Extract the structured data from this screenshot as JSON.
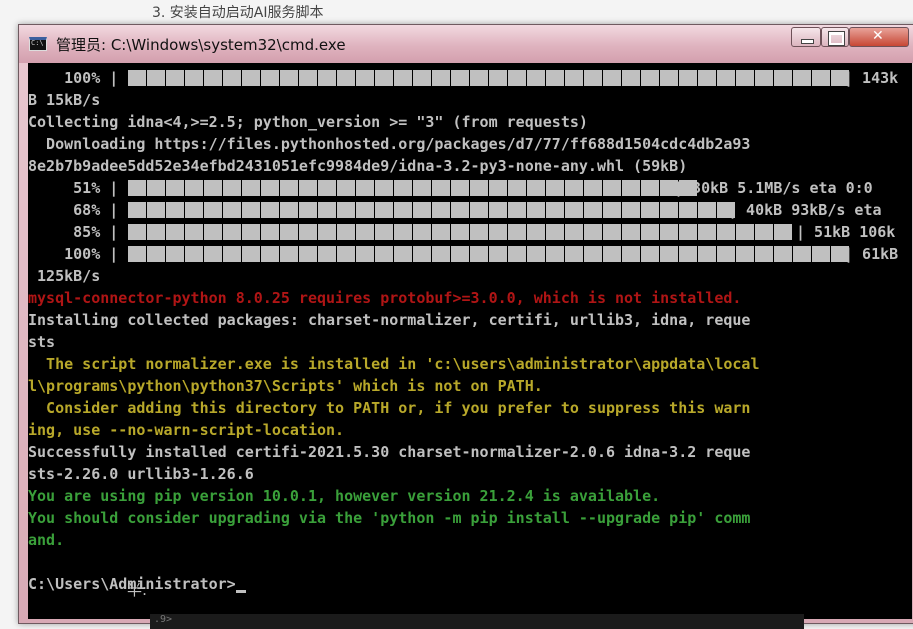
{
  "doc": {
    "heading": "3. 安装自动启动AI服务脚本",
    "footer_fragment": ".9>"
  },
  "window": {
    "title": "管理员: C:\\Windows\\system32\\cmd.exe"
  },
  "console": {
    "lines": [
      {
        "text": "B 15kB/s",
        "color": "gray"
      },
      {
        "text": "Collecting idna<4,>=2.5; python_version >= \"3\" (from requests)",
        "color": "gray"
      },
      {
        "text": "  Downloading https://files.pythonhosted.org/packages/d7/77/ff688d1504cdc4db2a93",
        "color": "gray"
      },
      {
        "text": "8e2b7b9adee5dd52e34efbd2431051efc9984de9/idna-3.2-py3-none-any.whl (59kB)",
        "color": "gray"
      },
      {
        "text": " 125kB/s",
        "color": "gray"
      },
      {
        "text": "mysql-connector-python 8.0.25 requires protobuf>=3.0.0, which is not installed.",
        "color": "red"
      },
      {
        "text": "Installing collected packages: charset-normalizer, certifi, urllib3, idna, reque",
        "color": "gray"
      },
      {
        "text": "sts",
        "color": "gray"
      },
      {
        "text": "  The script normalizer.exe is installed in 'c:\\users\\administrator\\appdata\\local",
        "color": "yellow"
      },
      {
        "text": "l\\programs\\python\\python37\\Scripts' which is not on PATH.",
        "color": "yellow"
      },
      {
        "text": "  Consider adding this directory to PATH or, if you prefer to suppress this warn",
        "color": "yellow"
      },
      {
        "text": "ing, use --no-warn-script-location.",
        "color": "yellow"
      },
      {
        "text": "Successfully installed certifi-2021.5.30 charset-normalizer-2.0.6 idna-3.2 reque",
        "color": "gray"
      },
      {
        "text": "sts-2.26.0 urllib3-1.26.6",
        "color": "gray"
      },
      {
        "text": "You are using pip version 10.0.1, however version 21.2.4 is available.",
        "color": "green"
      },
      {
        "text": "You should consider upgrading via the 'python -m pip install --upgrade pip' comm",
        "color": "green"
      },
      {
        "text": "and.",
        "color": "green"
      },
      {
        "text": "",
        "color": "gray"
      }
    ],
    "progress": [
      {
        "pct_label": "    100% |",
        "fraction": 1.0,
        "segments": 38,
        "tail": "| 143k"
      },
      {
        "pct_label": "     51% |",
        "fraction": 0.51,
        "segments": 30,
        "tail": "| 30kB 5.1MB/s eta 0:0"
      },
      {
        "pct_label": "     68% |",
        "fraction": 0.68,
        "segments": 32,
        "tail": "| 40kB 93kB/s eta"
      },
      {
        "pct_label": "     85% |",
        "fraction": 0.85,
        "segments": 35,
        "tail": "| 51kB 106k"
      },
      {
        "pct_label": "    100% |",
        "fraction": 1.0,
        "segments": 38,
        "tail": "| 61kB"
      }
    ],
    "prompt": "C:\\Users\\Administrator>",
    "ime_indicator": "半:"
  }
}
